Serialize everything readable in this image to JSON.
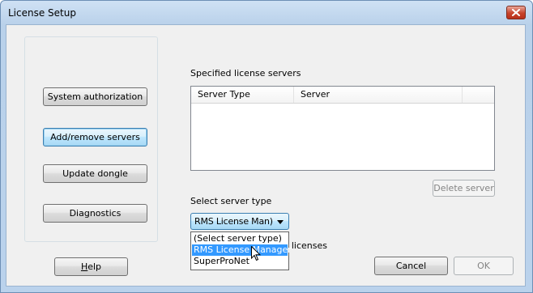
{
  "window": {
    "title": "License Setup"
  },
  "sidebar": {
    "buttons": [
      {
        "label": "System authorization"
      },
      {
        "label": "Add/remove servers"
      },
      {
        "label": "Update dongle"
      },
      {
        "label": "Diagnostics"
      }
    ],
    "help_mnemonic": "H",
    "help_rest": "elp"
  },
  "servers": {
    "list_label": "Specified license servers",
    "columns": [
      "Server Type",
      "Server"
    ],
    "rows": [],
    "delete_label": "Delete server"
  },
  "server_type": {
    "label": "Select server type",
    "selected": "RMS License Man)",
    "options": [
      "(Select server type)",
      "RMS License Manager",
      "SuperProNet"
    ],
    "highlighted_index": 1,
    "obscured_suffix_text": "k licenses"
  },
  "footer": {
    "cancel_label": "Cancel",
    "ok_label": "OK"
  },
  "icons": {
    "close": "close-icon",
    "dropdown": "chevron-down-icon",
    "cursor": "mouse-pointer-icon"
  },
  "colors": {
    "accent": "#3399ff",
    "close_button": "#c7432b",
    "active_button": "#bee6fd"
  }
}
